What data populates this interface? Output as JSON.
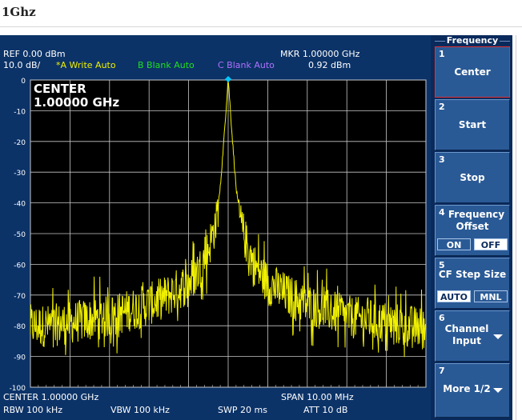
{
  "page": {
    "title": "1Ghz"
  },
  "header": {
    "ref": "REF  0.00 dBm",
    "scale": "10.0 dB/",
    "trace_a": "*A Write Auto",
    "trace_b": "B Blank Auto",
    "trace_c": "C Blank Auto",
    "marker_freq": "MKR 1.00000  GHz",
    "marker_level": "0.92 dBm"
  },
  "display": {
    "center_title": "CENTER",
    "center_value": "1.00000 GHz",
    "y_ticks": [
      "0",
      "-10",
      "-20",
      "-30",
      "-40",
      "-50",
      "-60",
      "-70",
      "-80",
      "-90",
      "-100"
    ]
  },
  "footer": {
    "center": "CENTER 1.00000  GHz",
    "span": "SPAN 10.00 MHz",
    "rbw": "RBW  100 kHz",
    "vbw": "VBW  100 kHz",
    "swp": "SWP  20 ms",
    "att": "ATT  10 dB"
  },
  "softkeys": {
    "menu_title": "Frequency",
    "keys": [
      {
        "num": "1",
        "label": "Center"
      },
      {
        "num": "2",
        "label": "Start"
      },
      {
        "num": "3",
        "label": "Stop"
      },
      {
        "num": "4",
        "label_line1": "Frequency",
        "label_line2": "Offset",
        "on": "ON",
        "off": "OFF"
      },
      {
        "num": "5",
        "label": "CF Step Size",
        "auto": "AUTO",
        "mnl": "MNL"
      },
      {
        "num": "6",
        "label_line1": "Channel",
        "label_line2": "Input"
      },
      {
        "num": "7",
        "label": "More 1/2"
      }
    ]
  },
  "colors": {
    "trace": "#f0f000",
    "marker": "#00c8ff",
    "grid": "#c8c8c8",
    "background": "#000000"
  },
  "chart_data": {
    "type": "line",
    "ylim": [
      -100,
      0
    ],
    "xlim": [
      0.995,
      1.005
    ],
    "x_unit": "GHz",
    "y_unit": "dBm",
    "grid": true,
    "peak": {
      "x": 1.0,
      "y": 0.92
    },
    "series": [
      {
        "x": [
          0.995,
          0.9955,
          0.996,
          0.9965,
          0.997,
          0.9975,
          0.998,
          0.9985,
          0.999,
          0.9993,
          0.9995,
          0.9997,
          0.9998,
          0.9999,
          1.0,
          1.0001,
          1.0002,
          1.0003,
          1.0005,
          1.0007,
          1.001,
          1.0015,
          1.002,
          1.0025,
          1.003,
          1.0035,
          1.004,
          1.0045,
          1.005
        ],
        "y": [
          -80,
          -80,
          -79,
          -78,
          -77,
          -75,
          -73,
          -70,
          -66,
          -61,
          -55,
          -46,
          -35,
          -18,
          0.92,
          -18,
          -35,
          -46,
          -55,
          -61,
          -66,
          -70,
          -73,
          -75,
          -77,
          -78,
          -79,
          -80,
          -81
        ]
      }
    ]
  }
}
